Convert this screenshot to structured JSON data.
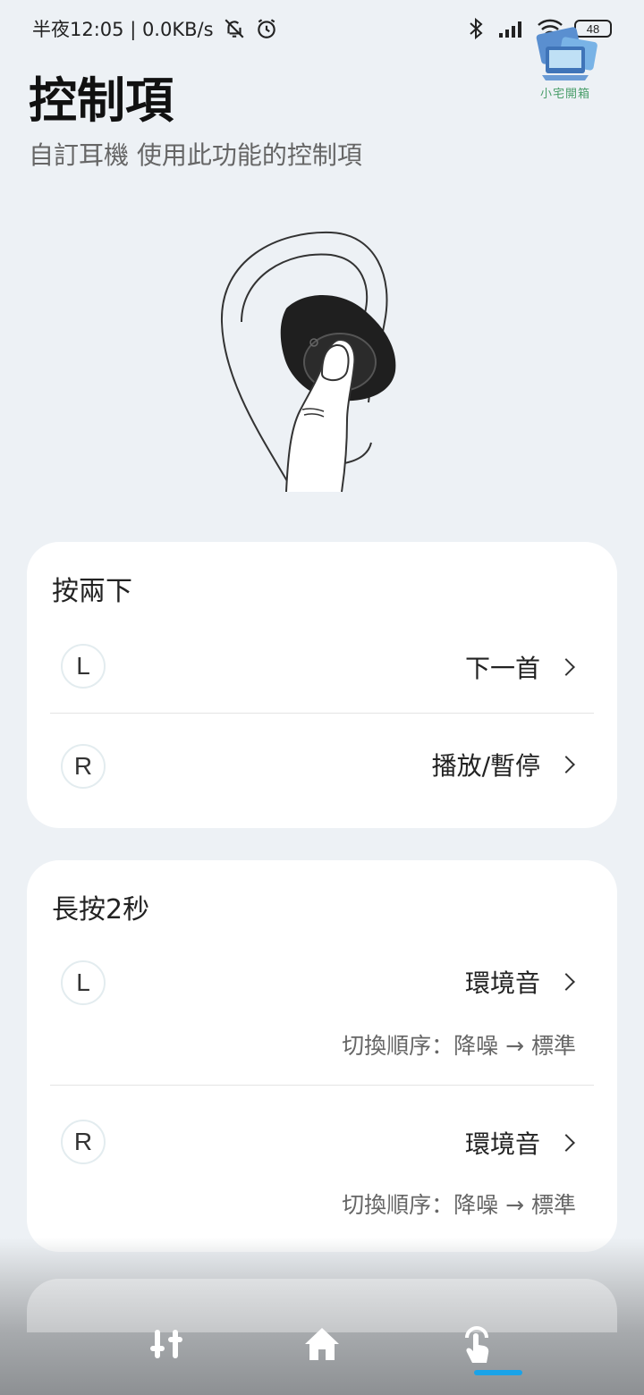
{
  "status_bar": {
    "time_info": "半夜12:05 | 0.0KB/s",
    "battery": "48"
  },
  "watermark": {
    "text": "小宅開箱"
  },
  "header": {
    "title": "控制項",
    "subtitle": "自訂耳機 使用此功能的控制項"
  },
  "double_tap": {
    "title": "按兩下",
    "left": {
      "side": "L",
      "value": "下一首"
    },
    "right": {
      "side": "R",
      "value": "播放/暫停"
    }
  },
  "long_press": {
    "title": "長按2秒",
    "left": {
      "side": "L",
      "value": "環境音",
      "sub": "切換順序：降噪 → 標準"
    },
    "right": {
      "side": "R",
      "value": "環境音",
      "sub": "切換順序：降噪 → 標準"
    }
  },
  "bottom_nav": {
    "items": [
      {
        "icon": "equalizer-icon",
        "active": false
      },
      {
        "icon": "home-icon",
        "active": false
      },
      {
        "icon": "touch-control-icon",
        "active": true
      }
    ],
    "accent_color": "#1aa3e8"
  }
}
